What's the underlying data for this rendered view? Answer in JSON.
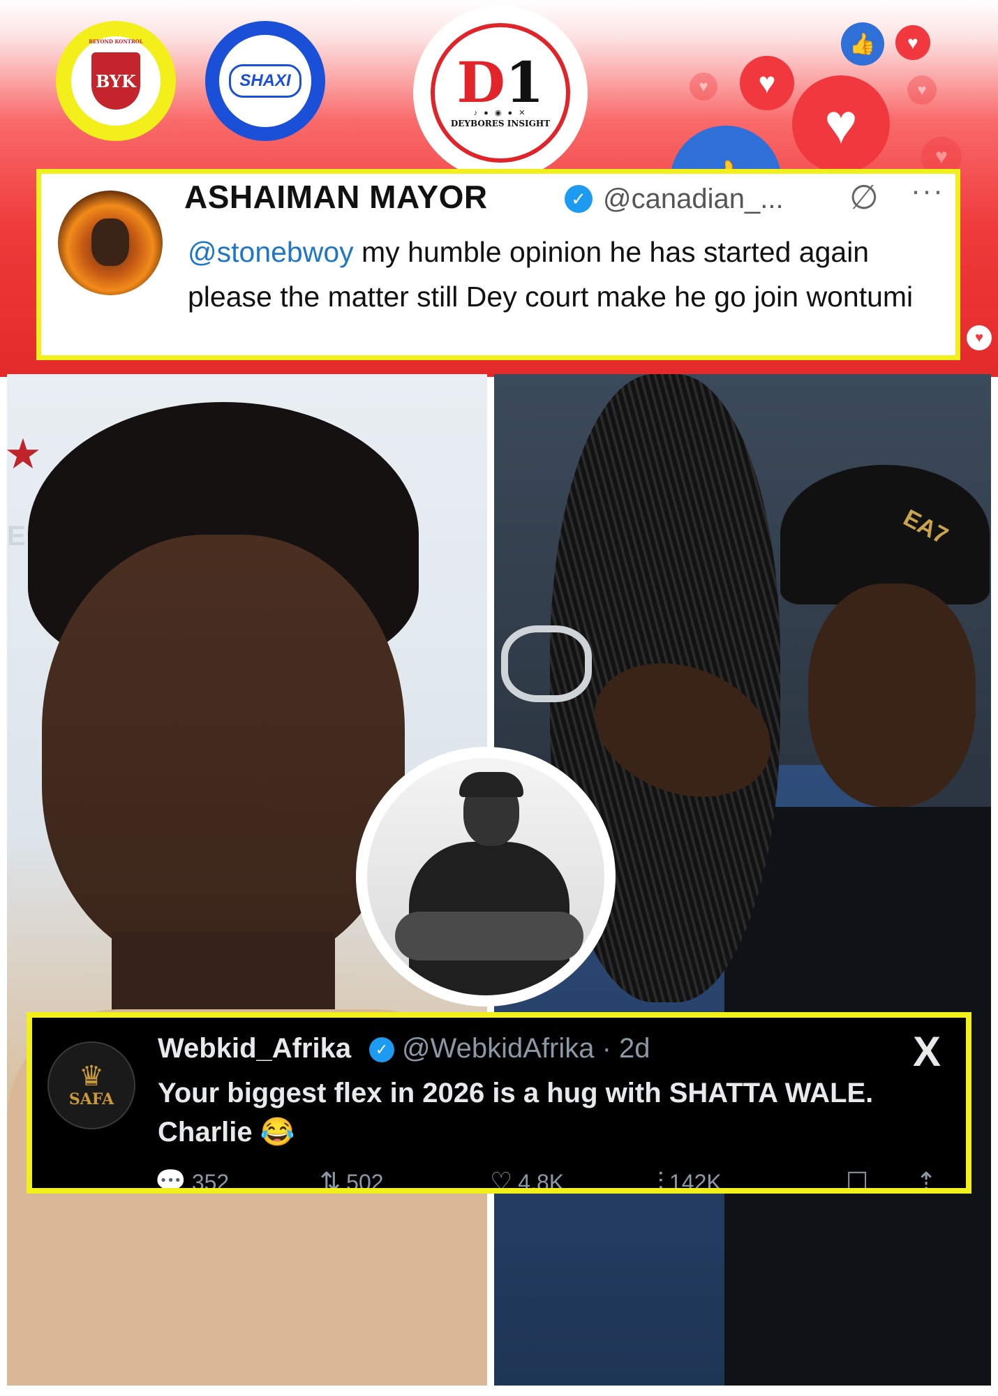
{
  "header": {
    "logos": {
      "byk": {
        "small": "BEYOND KONTROL",
        "mark": "BYK"
      },
      "shaxi": {
        "text": "SHAXI"
      },
      "d1": {
        "letters": "D",
        "digit": "1",
        "dots": "♪ ● ◉ ● ✕",
        "brand": "DEYBORES INSIGHT"
      }
    },
    "reactions": [
      "heart",
      "like",
      "heart",
      "like",
      "heart",
      "like",
      "heart"
    ]
  },
  "top_tweet": {
    "name": "ASHAIMAN MAYOR",
    "handle": "@canadian_...",
    "mention": "@stonebwoy",
    "text": " my humble opinion he has started again please the matter still Dey court make he go join wontumi",
    "grok_icon": "∅",
    "more_icon": "···"
  },
  "left_photo": {
    "brand": "ENDS"
  },
  "right_photo": {
    "cap_text": "EA7"
  },
  "bottom_tweet": {
    "name": "Webkid_Afrika",
    "handle": "@WebkidAfrika · 2d",
    "avatar_text": "SAFA",
    "text": "Your biggest flex in 2026 is a hug with SHATTA WALE. Charlie 😂",
    "x_logo": "X",
    "actions": {
      "replies": "352",
      "reposts": "502",
      "likes": "4.8K",
      "views": "142K"
    }
  },
  "colors": {
    "highlight_border": "#f1f01b",
    "header_red": "#e32a2a",
    "verified_blue": "#1d9bf0",
    "mention_blue": "#1d76c8"
  }
}
